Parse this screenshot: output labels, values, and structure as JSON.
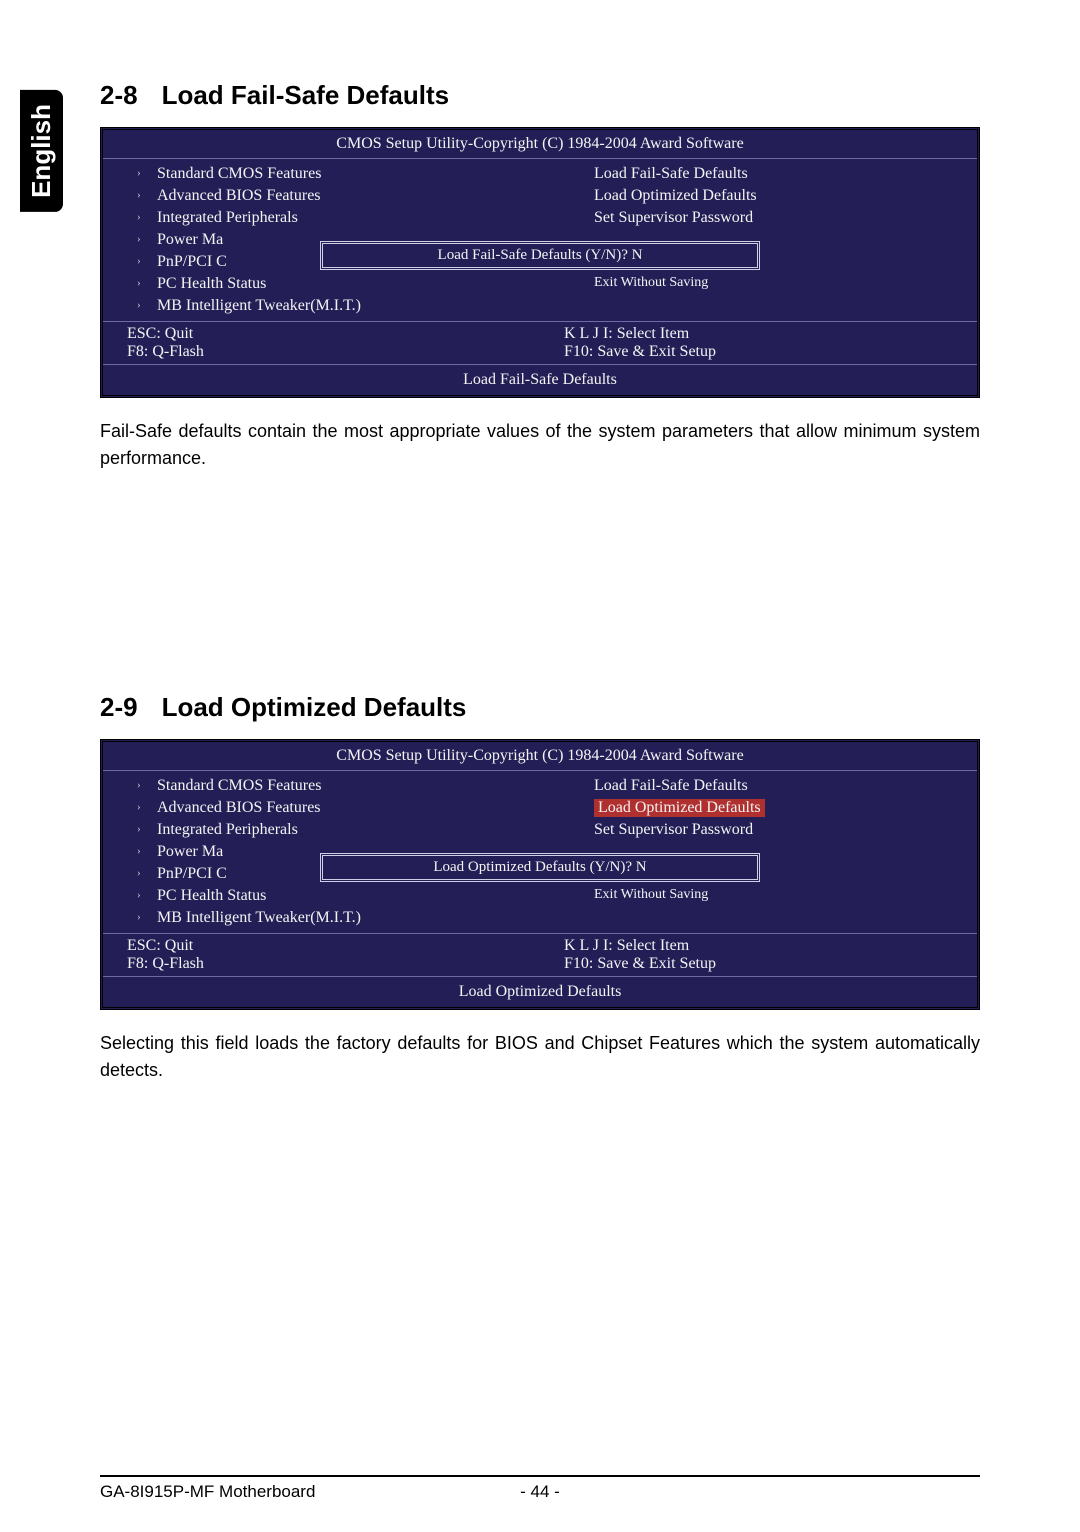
{
  "side_tab": "English",
  "section1": {
    "num": "2-8",
    "title": "Load Fail-Safe Defaults",
    "bios_title": "CMOS Setup Utility-Copyright (C) 1984-2004 Award Software",
    "left_items": [
      "Standard CMOS Features",
      "Advanced BIOS Features",
      "Integrated Peripherals",
      "Power Ma",
      "PnP/PCI C",
      "PC Health Status",
      "MB Intelligent Tweaker(M.I.T.)"
    ],
    "right_items": [
      "Load Fail-Safe Defaults",
      "Load Optimized Defaults",
      "Set Supervisor Password"
    ],
    "right_hidden": "Exit Without Saving",
    "dialog": "Load Fail-Safe Defaults (Y/N)? N",
    "keys_left": [
      "ESC: Quit",
      "F8: Q-Flash"
    ],
    "keys_right": [
      "K L J I: Select Item",
      "F10: Save & Exit Setup"
    ],
    "help": "Load Fail-Safe Defaults",
    "body": "Fail-Safe defaults contain the most appropriate values of the system parameters that allow minimum system performance."
  },
  "section2": {
    "num": "2-9",
    "title": "Load Optimized Defaults",
    "bios_title": "CMOS Setup Utility-Copyright (C) 1984-2004 Award Software",
    "left_items": [
      "Standard CMOS Features",
      "Advanced BIOS Features",
      "Integrated Peripherals",
      "Power Ma",
      "PnP/PCI C",
      "PC Health Status",
      "MB Intelligent Tweaker(M.I.T.)"
    ],
    "right_items_before": [
      "Load Fail-Safe Defaults"
    ],
    "right_highlight": "Load Optimized Defaults",
    "right_items_after": [
      "Set Supervisor Password"
    ],
    "right_hidden": "Exit Without Saving",
    "dialog": "Load Optimized Defaults (Y/N)? N",
    "keys_left": [
      "ESC: Quit",
      "F8: Q-Flash"
    ],
    "keys_right": [
      "K L J I: Select Item",
      "F10: Save & Exit Setup"
    ],
    "help": "Load Optimized Defaults",
    "body": "Selecting this field loads the factory defaults for BIOS and Chipset Features which the system automatically detects."
  },
  "footer": {
    "left": "GA-8I915P-MF Motherboard",
    "page": "- 44 -"
  }
}
